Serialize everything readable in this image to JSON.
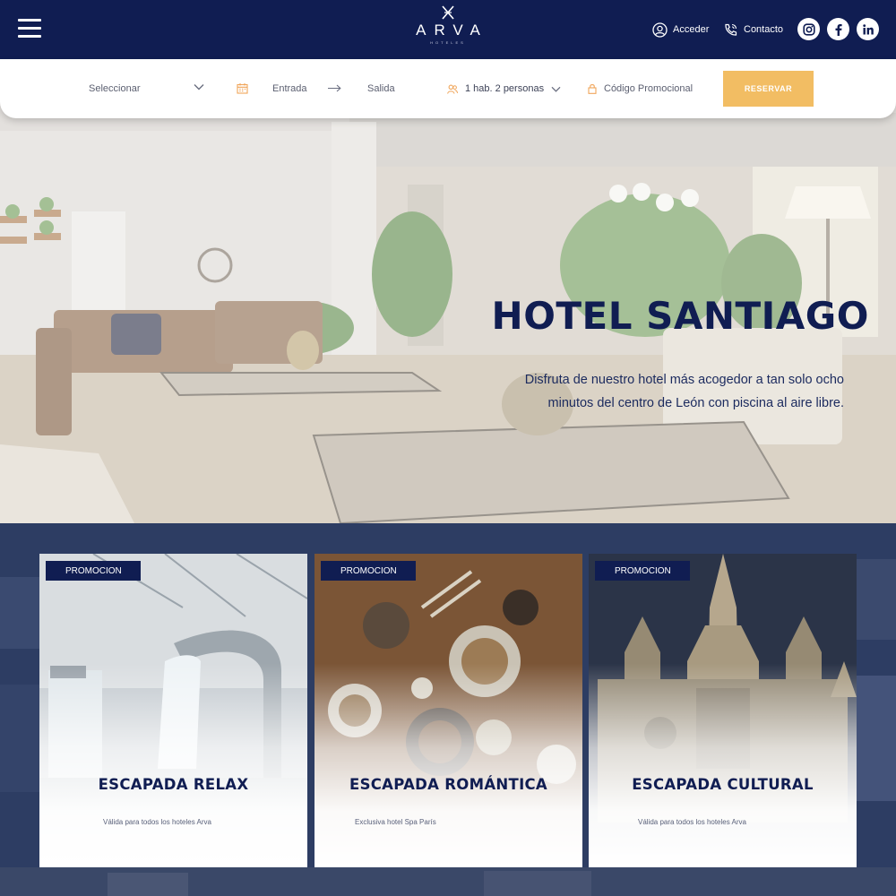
{
  "header": {
    "logo_text": "ARVA",
    "logo_subtext": "HOTELES",
    "links": [
      {
        "label": "Acceder",
        "icon": "user-icon"
      },
      {
        "label": "Contacto",
        "icon": "phone-icon"
      }
    ],
    "social": [
      "instagram-icon",
      "facebook-icon",
      "linkedin-icon"
    ]
  },
  "booking": {
    "select_label": "Seleccionar",
    "checkin_label": "Entrada",
    "checkout_label": "Salida",
    "guests_label": "1 hab. 2 personas",
    "promo_label": "Código Promocional",
    "reserve_label": "RESERVAR"
  },
  "hero": {
    "title": "HOTEL SANTIAGO",
    "description": "Disfruta de nuestro hotel más acogedor a tan solo ocho minutos del centro de León con piscina al aire libre."
  },
  "promotions": [
    {
      "badge": "PROMOCION",
      "title": "ESCAPADA RELAX",
      "subtitle": "Válida para todos los hoteles Arva"
    },
    {
      "badge": "PROMOCION",
      "title": "ESCAPADA ROMÁNTICA",
      "subtitle": "Exclusiva hotel Spa París"
    },
    {
      "badge": "PROMOCION",
      "title": "ESCAPADA CULTURAL",
      "subtitle": "Válida para todos los hoteles Arva"
    }
  ],
  "colors": {
    "navy": "#101d52",
    "accent_gold": "#f2bd63",
    "icon_orange": "#f0a55a"
  }
}
